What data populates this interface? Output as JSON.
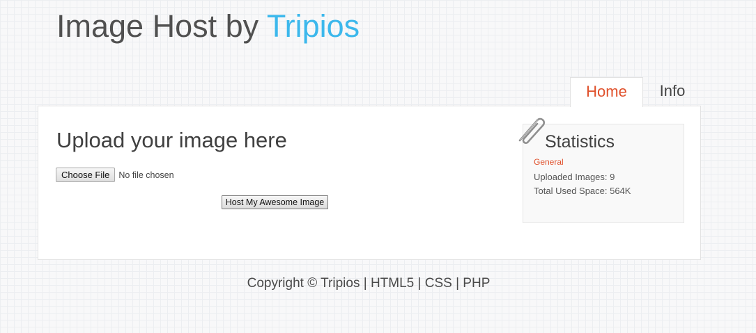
{
  "header": {
    "title_prefix": "Image Host by ",
    "title_brand": "Tripios"
  },
  "tabs": [
    {
      "label": "Home",
      "active": true
    },
    {
      "label": "Info",
      "active": false
    }
  ],
  "upload": {
    "heading": "Upload your image here",
    "choose_label": "Choose File",
    "file_status": "No file chosen",
    "submit_label": "Host My Awesome Image"
  },
  "stats": {
    "title": "Statistics",
    "section": "General",
    "uploaded": "Uploaded Images: 9",
    "space": "Total Used Space: 564K",
    "icon": "paperclip-icon"
  },
  "footer": {
    "text": "Copyright © Tripios | HTML5 | CSS | PHP"
  },
  "colors": {
    "brand": "#3cb8ec",
    "accent": "#e0512c",
    "text": "#555555"
  }
}
